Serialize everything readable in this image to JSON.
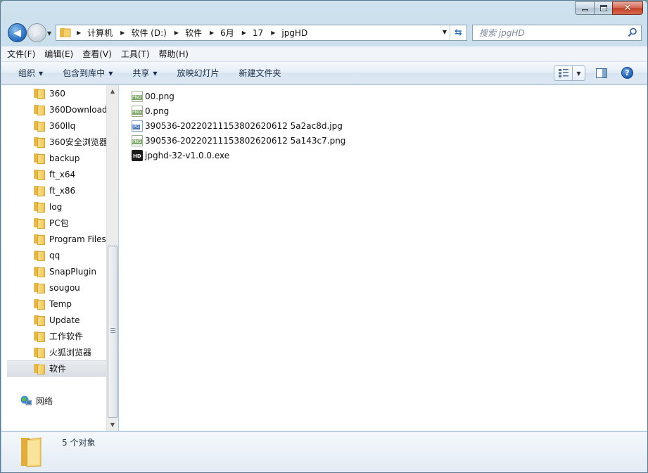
{
  "window": {
    "caption_buttons": [
      "minimize",
      "maximize",
      "close"
    ]
  },
  "address": {
    "crumbs": [
      "计算机",
      "软件 (D:)",
      "软件",
      "6月",
      "17",
      "jpgHD"
    ]
  },
  "search": {
    "placeholder": "搜索 jpgHD"
  },
  "menubar": {
    "items": [
      "文件(F)",
      "编辑(E)",
      "查看(V)",
      "工具(T)",
      "帮助(H)"
    ]
  },
  "commandbar": {
    "organize": "组织",
    "include_library": "包含到库中",
    "share": "共享",
    "slideshow": "放映幻灯片",
    "new_folder": "新建文件夹"
  },
  "navpane": {
    "folders": [
      "360",
      "360Download",
      "360llq",
      "360安全浏览器",
      "backup",
      "ft_x64",
      "ft_x86",
      "log",
      "PC包",
      "Program Files",
      "qq",
      "SnapPlugin",
      "sougou",
      "Temp",
      "Update",
      "工作软件",
      "火狐浏览器",
      "软件"
    ],
    "selected": "软件",
    "network": "网络"
  },
  "files": [
    {
      "name": "00.png",
      "type": "png"
    },
    {
      "name": "0.png",
      "type": "png"
    },
    {
      "name": "390536-20220211153802620612 5a2ac8d.jpg",
      "type": "jpg"
    },
    {
      "name": "390536-20220211153802620612 5a143c7.png",
      "type": "png"
    },
    {
      "name": "jpghd-32-v1.0.0.exe",
      "type": "exe"
    }
  ],
  "details": {
    "count_text": "5 个对象"
  },
  "colors": {
    "window_frame": "#b9d3e6",
    "selection": "#dadfe5",
    "folder": "#f2c95a"
  }
}
